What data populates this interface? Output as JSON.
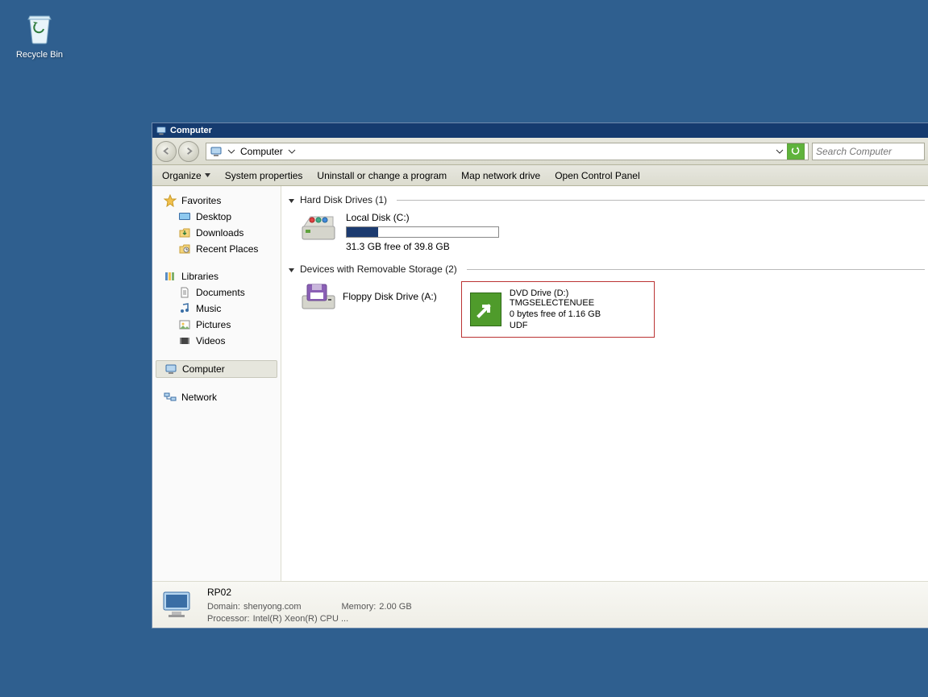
{
  "desktop": {
    "recycle_bin": "Recycle Bin"
  },
  "window": {
    "title": "Computer",
    "breadcrumb": "Computer",
    "search_placeholder": "Search Computer"
  },
  "cmdbar": {
    "organize": "Organize",
    "system_properties": "System properties",
    "uninstall": "Uninstall or change a program",
    "map_drive": "Map network drive",
    "control_panel": "Open Control Panel"
  },
  "sidebar": {
    "favorites": "Favorites",
    "desktop": "Desktop",
    "downloads": "Downloads",
    "recent": "Recent Places",
    "libraries": "Libraries",
    "documents": "Documents",
    "music": "Music",
    "pictures": "Pictures",
    "videos": "Videos",
    "computer": "Computer",
    "network": "Network"
  },
  "content": {
    "group_hdd": "Hard Disk Drives (1)",
    "local_disk": {
      "label": "Local Disk (C:)",
      "freeline": "31.3 GB free of 39.8 GB",
      "used_percent": 21
    },
    "group_removable": "Devices with Removable Storage (2)",
    "floppy": "Floppy Disk Drive (A:)",
    "dvd": {
      "line1": "DVD Drive (D:) TMGSELECTENUEE",
      "line2": "0 bytes free of 1.16 GB",
      "line3": "UDF"
    }
  },
  "details": {
    "name": "RP02",
    "domain_label": "Domain:",
    "domain_value": "shenyong.com",
    "memory_label": "Memory:",
    "memory_value": "2.00 GB",
    "processor_label": "Processor:",
    "processor_value": "Intel(R) Xeon(R) CPU      ..."
  }
}
